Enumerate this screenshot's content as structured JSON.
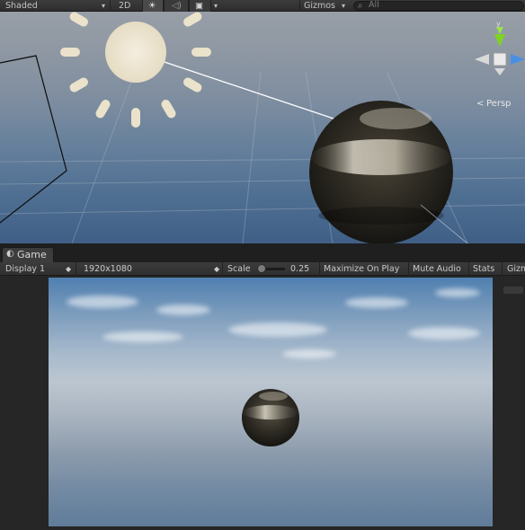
{
  "scene_toolbar": {
    "shading_mode": "Shaded",
    "mode_2d": "2D",
    "gizmos_label": "Gizmos",
    "search_placeholder": "All"
  },
  "scene_view": {
    "projection_label": "Persp",
    "gizmo_axis_y": "y"
  },
  "game_tab": {
    "label": "Game"
  },
  "game_toolbar": {
    "display": "Display 1",
    "resolution": "1920x1080",
    "scale_label": "Scale",
    "scale_value": "0.25",
    "maximize_label": "Maximize On Play",
    "mute_label": "Mute Audio",
    "stats_label": "Stats",
    "gizmos_label": "Gizm"
  },
  "colors": {
    "editor_bg": "#2b2b2b",
    "toolbar_bg": "#383838",
    "gizmo_y": "#7ed321",
    "gizmo_x": "#e84a4a",
    "gizmo_z": "#4a90e2"
  }
}
